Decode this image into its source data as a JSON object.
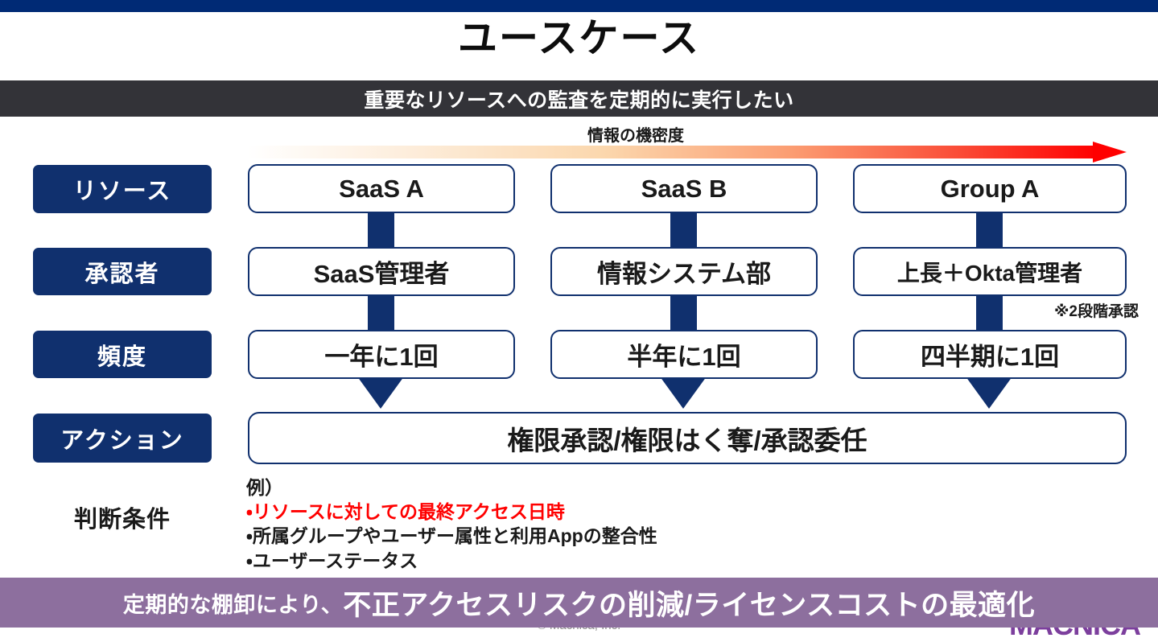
{
  "theme": {
    "navy": "#10306e",
    "top_bar_navy": "#002a75",
    "dark_band": "#333338",
    "purple": "#8d6f9e",
    "highlight_red": "#ff0000",
    "gradient_end": "#ff0000"
  },
  "header": {
    "title": "ユースケース",
    "subtitle": "重要なリソースへの監査を定期的に実行したい"
  },
  "gradient_axis": {
    "label": "情報の機密度",
    "direction": "left-to-right",
    "from": "low",
    "to": "high"
  },
  "matrix": {
    "row_labels": [
      {
        "id": "resource",
        "label": "リソース"
      },
      {
        "id": "approver",
        "label": "承認者"
      },
      {
        "id": "frequency",
        "label": "頻度"
      },
      {
        "id": "action",
        "label": "アクション"
      }
    ],
    "criteria_label": "判断条件",
    "columns": [
      {
        "id": "col1",
        "resource": "SaaS A",
        "approver": "SaaS管理者",
        "frequency": "一年に1回"
      },
      {
        "id": "col2",
        "resource": "SaaS B",
        "approver": "情報システム部",
        "frequency": "半年に1回"
      },
      {
        "id": "col3",
        "resource": "Group A",
        "approver": "上長＋Okta管理者",
        "frequency": "四半期に1回",
        "note": "※2段階承認"
      }
    ],
    "action": "権限承認/権限はく奪/承認委任"
  },
  "criteria": {
    "example_label": "例）",
    "items": [
      {
        "text": "・リソースに対しての最終アクセス日時",
        "highlight": true
      },
      {
        "text": "・所属グループやユーザー属性と利用Appの整合性",
        "highlight": false
      },
      {
        "text": "・ユーザーステータス",
        "highlight": false
      }
    ]
  },
  "bottom_banner": {
    "lead": "定期的な棚卸により、",
    "emphasis": "不正アクセスリスクの削減/ライセンスコストの最適化"
  },
  "footer": {
    "copyright": "© Macnica, Inc.",
    "brand": "MACNICA"
  }
}
